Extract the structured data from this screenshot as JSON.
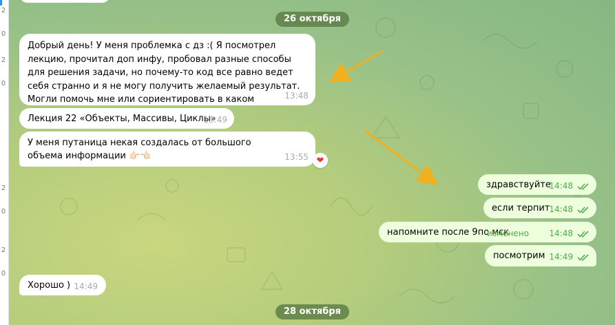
{
  "chat": {
    "date_separators": [
      "26 октября",
      "28 октября"
    ],
    "incoming": [
      {
        "text": "Добрый день! У меня проблемка с дз :( Я посмотрел лекцию, прочитал доп инфу, пробовал разные способы для решения задачи, но почему-то код все равно ведет себя странно и я не могу получить желаемый результат. Могли помочь мне или сориентировать в каком направлении двигаться?",
        "time": "13:48"
      },
      {
        "text": "Лекция 22 «Объекты, Массивы, Циклы»",
        "time": "13:49"
      },
      {
        "text": "У меня путаница некая создалась от большого объема информации 👉🏻👈🏻",
        "time": "13:55",
        "reaction": "❤"
      },
      {
        "text": "Хорошо )",
        "time": "14:49"
      }
    ],
    "outgoing": [
      {
        "text": "здравствуйте",
        "time": "14:48"
      },
      {
        "text": "если терпит",
        "time": "14:48"
      },
      {
        "text": "напомните после 9по мск",
        "time": "14:48",
        "edited": "изменено"
      },
      {
        "text": "посмотрим",
        "time": "14:49"
      }
    ]
  },
  "sidebar_fragments": [
    "2",
    "0",
    "2",
    "0",
    "2",
    "0",
    "2",
    "0"
  ],
  "colors": {
    "outgoing_bubble": "#eeffde",
    "incoming_bubble": "#ffffff",
    "read_check": "#4fae4e",
    "reaction_heart": "#e53935",
    "annotation_arrow": "#f0b020",
    "date_pill": "#5c7d46"
  },
  "icons": [
    "double-check-icon",
    "heart-reaction-icon",
    "annotation-arrow"
  ]
}
